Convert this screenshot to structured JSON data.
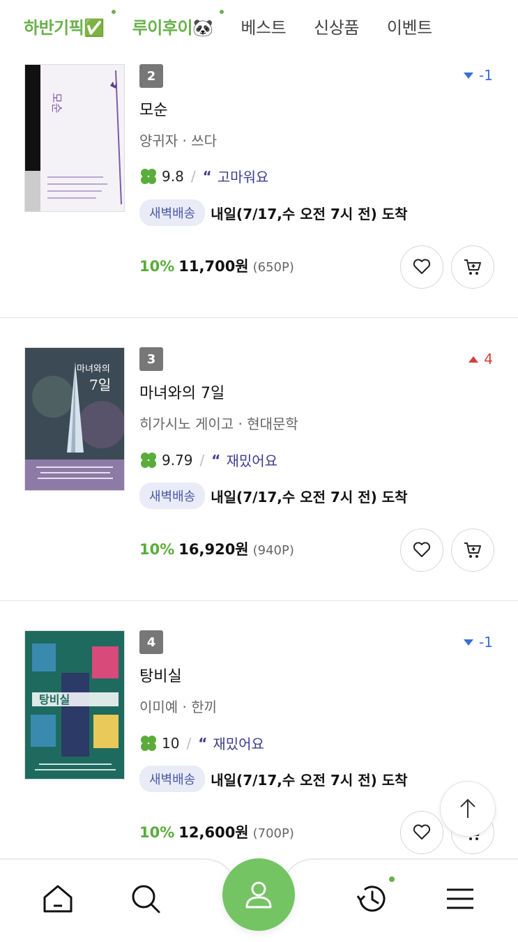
{
  "tabs": [
    {
      "label": "하반기픽✅",
      "style": "green",
      "dot": true
    },
    {
      "label": "루이후이🐼",
      "style": "green",
      "dot": true
    },
    {
      "label": "베스트",
      "style": "dark",
      "dot": false
    },
    {
      "label": "신상품",
      "style": "dark",
      "dot": false
    },
    {
      "label": "이벤트",
      "style": "dark",
      "dot": false
    }
  ],
  "books": [
    {
      "rank": "2",
      "change": {
        "direction": "down",
        "value": "-1"
      },
      "title": "모순",
      "author": "양귀자 · 쓰다",
      "rating": "9.8",
      "review": "고마워요",
      "badge": "새벽배송",
      "delivery": "내일(7/17,수 오전 7시 전) 도착",
      "discount": "10%",
      "price": "11,700원",
      "points": "(650P)",
      "cover": {
        "title": "모순",
        "bg": "#f4f1f6",
        "accent": "#7f5aa8"
      }
    },
    {
      "rank": "3",
      "change": {
        "direction": "up",
        "value": "4"
      },
      "title": "마녀와의 7일",
      "author": "히가시노 게이고 · 현대문학",
      "rating": "9.79",
      "review": "재밌어요",
      "badge": "새벽배송",
      "delivery": "내일(7/17,수 오전 7시 전) 도착",
      "discount": "10%",
      "price": "16,920원",
      "points": "(940P)",
      "cover": {
        "title": "마녀와의 7일",
        "bg": "#3c4a55",
        "accent": "#8e7aa6"
      }
    },
    {
      "rank": "4",
      "change": {
        "direction": "down",
        "value": "-1"
      },
      "title": "탕비실",
      "author": "이미예 · 한끼",
      "rating": "10",
      "review": "재밌어요",
      "badge": "새벽배송",
      "delivery": "내일(7/17,수 오전 7시 전) 도착",
      "discount": "10%",
      "price": "12,600원",
      "points": "(700P)",
      "cover": {
        "title": "탕비실",
        "bg": "#1f6a5e",
        "accent": "#d74a7a"
      }
    }
  ],
  "colors": {
    "brand_green": "#6ab04c",
    "price_green": "#5aac3b",
    "down_blue": "#3b6fd6",
    "up_red": "#d93b3b",
    "badge_bg": "#e9ecf7",
    "badge_text": "#4b57a6"
  },
  "nav": {
    "items": [
      "home-icon",
      "search-icon",
      "profile-icon",
      "history-icon",
      "menu-icon"
    ]
  }
}
